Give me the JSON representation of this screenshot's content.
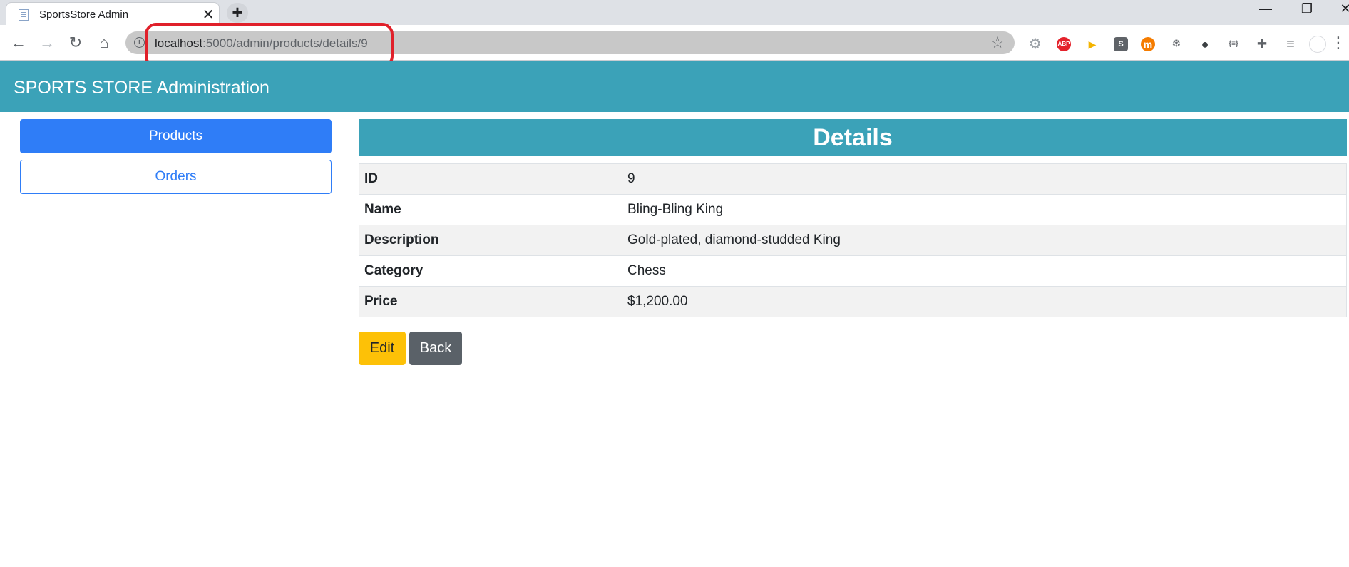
{
  "browser": {
    "tab_title": "SportsStore Admin",
    "tab_close": "✕",
    "new_tab": "+",
    "url_host": "localhost",
    "url_rest": ":5000/admin/products/details/9",
    "window_controls": [
      "—",
      "❐",
      "✕"
    ],
    "extensions": [
      {
        "name": "settings-extension-icon",
        "glyph": "⚙",
        "color": "#9aa0a6"
      },
      {
        "name": "adblock-extension-icon",
        "glyph": "ABP",
        "color": "#e4222b"
      },
      {
        "name": "play-extension-icon",
        "glyph": "▶",
        "color": "#f4b400"
      },
      {
        "name": "s-extension-icon",
        "glyph": "S",
        "color": "#5f6368"
      },
      {
        "name": "m-extension-icon",
        "glyph": "m",
        "color": "#f57c00"
      },
      {
        "name": "signal-extension-icon",
        "glyph": "❄",
        "color": "#5f6368"
      },
      {
        "name": "balls-extension-icon",
        "glyph": "●",
        "color": "#3c4043"
      },
      {
        "name": "json-extension-icon",
        "glyph": "{≡}",
        "color": "#5f6368"
      },
      {
        "name": "puzzle-extension-icon",
        "glyph": "✚",
        "color": "#5f6368"
      },
      {
        "name": "playlist-extension-icon",
        "glyph": "≡",
        "color": "#5f6368"
      }
    ]
  },
  "app": {
    "title": "SPORTS STORE Administration"
  },
  "sidebar": {
    "products_label": "Products",
    "orders_label": "Orders"
  },
  "details": {
    "heading": "Details",
    "rows": [
      {
        "key": "ID",
        "value": "9"
      },
      {
        "key": "Name",
        "value": "Bling-Bling King"
      },
      {
        "key": "Description",
        "value": "Gold-plated, diamond-studded King"
      },
      {
        "key": "Category",
        "value": "Chess"
      },
      {
        "key": "Price",
        "value": "$1,200.00"
      }
    ],
    "edit_label": "Edit",
    "back_label": "Back"
  },
  "colors": {
    "header": "#3ba2b8",
    "primary": "#2f7df7",
    "warning": "#fdc107",
    "secondary": "#5a6168",
    "annotation": "#e0202a"
  }
}
